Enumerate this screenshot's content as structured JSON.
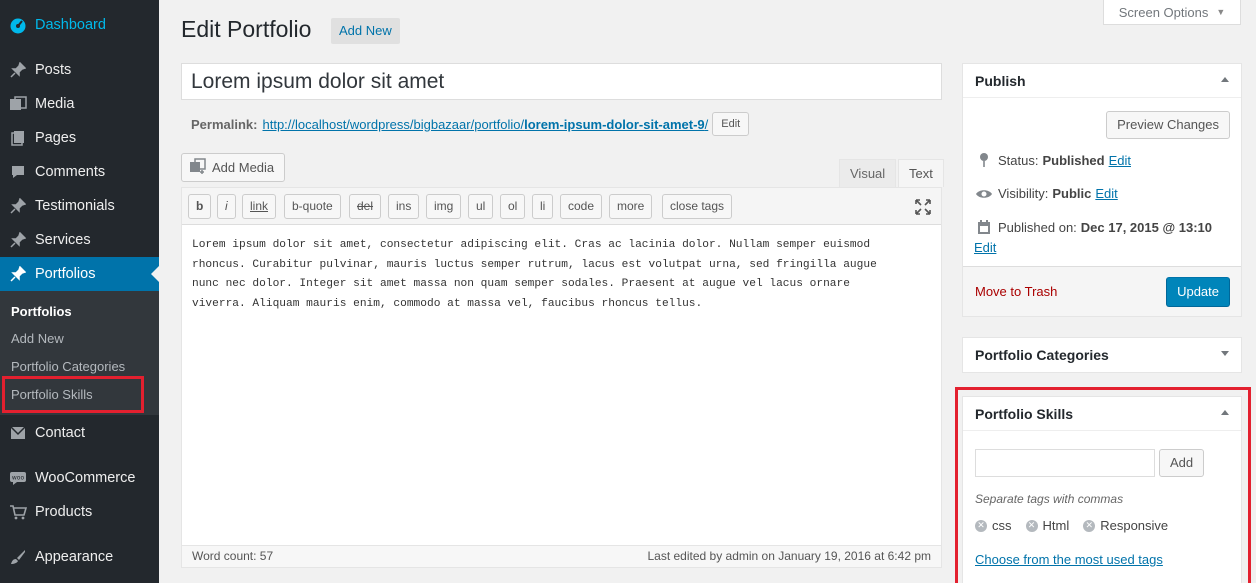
{
  "sidebar": {
    "items": [
      {
        "label": "Dashboard",
        "icon": "dashboard-icon"
      },
      {
        "label": "Posts",
        "icon": "pin-icon"
      },
      {
        "label": "Media",
        "icon": "media-icon"
      },
      {
        "label": "Pages",
        "icon": "pages-icon"
      },
      {
        "label": "Comments",
        "icon": "comment-icon"
      },
      {
        "label": "Testimonials",
        "icon": "pin-icon"
      },
      {
        "label": "Services",
        "icon": "pin-icon"
      },
      {
        "label": "Portfolios",
        "icon": "pin-icon"
      },
      {
        "label": "Contact",
        "icon": "mail-icon"
      },
      {
        "label": "WooCommerce",
        "icon": "woo-icon"
      },
      {
        "label": "Products",
        "icon": "cart-icon"
      },
      {
        "label": "Appearance",
        "icon": "brush-icon"
      }
    ],
    "submenu": [
      "Portfolios",
      "Add New",
      "Portfolio Categories",
      "Portfolio Skills"
    ]
  },
  "header": {
    "title": "Edit Portfolio",
    "add_new": "Add New",
    "screen_options": "Screen Options"
  },
  "post": {
    "title": "Lorem ipsum dolor sit amet",
    "permalink_label": "Permalink:",
    "permalink_base": "http://localhost/wordpress/bigbazaar/portfolio/",
    "permalink_slug": "lorem-ipsum-dolor-sit-amet-9",
    "permalink_tail": "/",
    "permalink_edit": "Edit"
  },
  "editor": {
    "add_media": "Add Media",
    "tab_visual": "Visual",
    "tab_text": "Text",
    "quicktags": [
      "b",
      "i",
      "link",
      "b-quote",
      "del",
      "ins",
      "img",
      "ul",
      "ol",
      "li",
      "code",
      "more",
      "close tags"
    ],
    "content_lines": [
      "Lorem ipsum dolor sit amet, consectetur adipiscing elit. Cras ac lacinia dolor. Nullam semper euismod",
      "rhoncus. Curabitur pulvinar, mauris luctus semper rutrum, lacus est volutpat urna, sed fringilla augue",
      "nunc nec dolor. Integer sit amet massa non quam semper sodales. Praesent at augue vel lacus ornare",
      "viverra. Aliquam mauris enim, commodo at massa vel, faucibus rhoncus tellus."
    ],
    "word_count": "Word count: 57",
    "last_edited": "Last edited by admin on January 19, 2016 at 6:42 pm"
  },
  "publish": {
    "title": "Publish",
    "preview": "Preview Changes",
    "status_label": "Status:",
    "status_value": "Published",
    "visibility_label": "Visibility:",
    "visibility_value": "Public",
    "published_label": "Published on:",
    "published_value": "Dec 17, 2015 @ 13:10",
    "edit": "Edit",
    "move_to_trash": "Move to Trash",
    "update": "Update"
  },
  "categories": {
    "title": "Portfolio Categories"
  },
  "skills": {
    "title": "Portfolio Skills",
    "add": "Add",
    "help": "Separate tags with commas",
    "tags": [
      "css",
      "Html",
      "Responsive"
    ],
    "choose": "Choose from the most used tags"
  },
  "colors": {
    "sidebar_bg": "#23282d",
    "accent": "#0073aa",
    "highlight_border": "#e3202f",
    "primary_button": "#0085ba"
  }
}
